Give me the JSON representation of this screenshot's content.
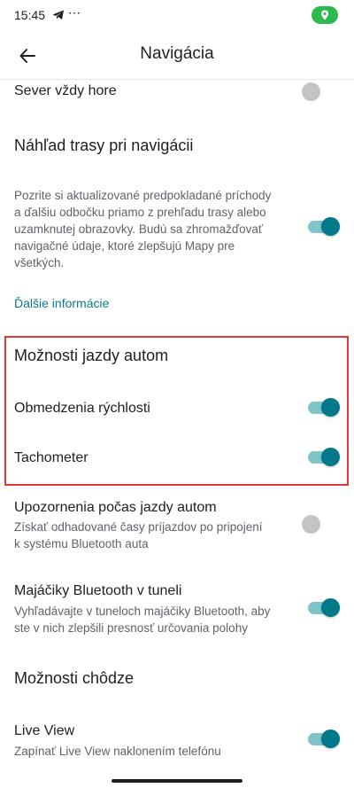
{
  "status": {
    "time": "15:45",
    "extra": "⋯"
  },
  "header": {
    "title": "Navigácia"
  },
  "settings": {
    "north_up": {
      "label": "Sever vždy hore",
      "on": false
    },
    "route_preview": {
      "title": "Náhľad trasy pri navigácii",
      "description_lines": [
        "Pozrite si aktualizované predpokladané príchody",
        "a ďalšiu odbočku priamo z prehľadu trasy alebo",
        "uzamknutej obrazovky. Budú sa zhromažďovať",
        "navigačné údaje, ktoré zlepšujú Mapy pre",
        "všetkých."
      ],
      "on": true
    },
    "more_info_link": "Ďalšie informácie",
    "driving_options": {
      "title": "Možnosti jazdy autom",
      "speed_limits": {
        "label": "Obmedzenia rýchlosti",
        "on": true
      },
      "speedometer": {
        "label": "Tachometer",
        "on": true
      }
    },
    "driving_notifications": {
      "label": "Upozornenia počas jazdy autom",
      "description_lines": [
        "Získať odhadované časy príjazdov po pripojení",
        "k systému Bluetooth auta"
      ],
      "on": false
    },
    "tunnel_beacons": {
      "label": "Majáčiky Bluetooth v tuneli",
      "description_lines": [
        "Vyhľadávajte v tuneloch majáčiky Bluetooth, aby",
        "ste v nich zlepšili presnosť určovania polohy"
      ],
      "on": true
    },
    "walking_options": {
      "title": "Možnosti chôdze"
    },
    "live_view": {
      "label": "Live View",
      "description": "Zapínať Live View naklonením telefónu",
      "on": true
    }
  },
  "colors": {
    "accent": "#00798a",
    "track_on": "#7ec5c8",
    "highlight": "#e53935",
    "location_pill": "#2db94d"
  },
  "icons": {
    "back": "arrow-left-icon",
    "telegram": "telegram-icon",
    "location": "location-pin-icon"
  }
}
